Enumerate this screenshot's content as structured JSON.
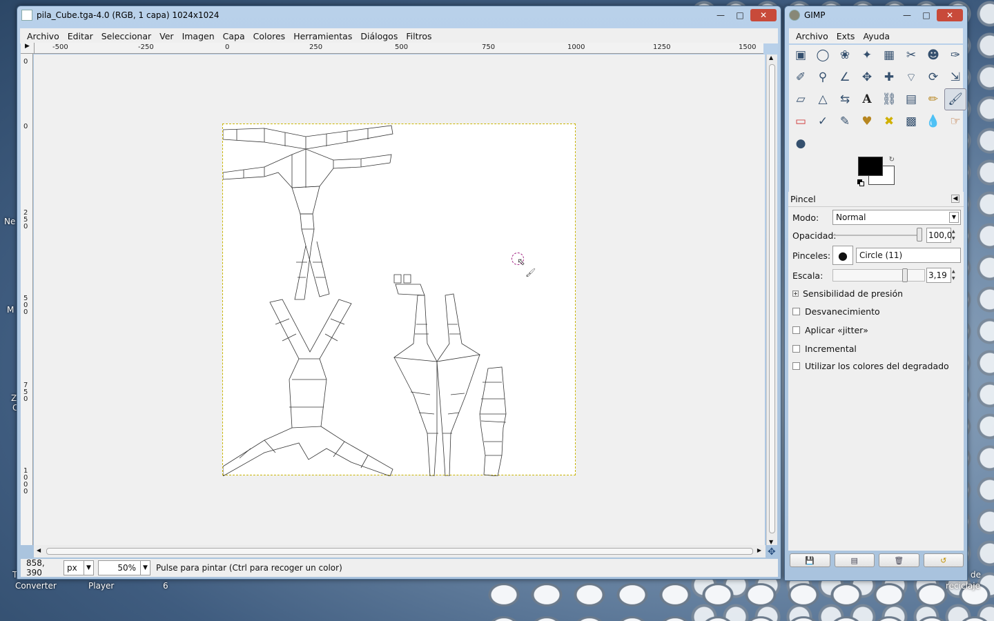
{
  "desktop": {
    "labels": [
      "Ne",
      "M",
      "Z",
      "C",
      "Converter",
      "Player",
      "6",
      "T",
      "de",
      "reciclaje"
    ]
  },
  "image_window": {
    "title": "pila_Cube.tga-4.0 (RGB, 1 capa) 1024x1024",
    "menu": [
      "Archivo",
      "Editar",
      "Seleccionar",
      "Ver",
      "Imagen",
      "Capa",
      "Colores",
      "Herramientas",
      "Diálogos",
      "Filtros"
    ],
    "ruler_top_labels": [
      "-500",
      "-250",
      "0",
      "250",
      "500",
      "750",
      "1000",
      "1250",
      "1500"
    ],
    "ruler_left_labels": [
      "0",
      "0",
      "250",
      "500",
      "750",
      "1000"
    ],
    "status": {
      "coords": "858, 390",
      "unit": "px",
      "zoom": "50%",
      "message": "Pulse para pintar (Ctrl para recoger un color)"
    }
  },
  "toolbox_window": {
    "title": "GIMP",
    "menu": [
      "Archivo",
      "Exts",
      "Ayuda"
    ],
    "tools": [
      "rect-select",
      "ellipse-select",
      "free-select",
      "fuzzy-select",
      "color-select",
      "scissors-select",
      "foreground-select",
      "paths",
      "color-picker",
      "zoom",
      "measure",
      "move",
      "align",
      "crop",
      "rotate",
      "scale",
      "shear",
      "perspective",
      "flip",
      "text",
      "bucket-fill",
      "blend",
      "pencil",
      "paintbrush",
      "eraser",
      "airbrush",
      "ink",
      "clone",
      "heal",
      "perspective-clone",
      "blur",
      "smudge",
      "dodge-burn"
    ],
    "active_tool": "paintbrush",
    "colors": {
      "foreground": "#000000",
      "background": "#ffffff"
    }
  },
  "tool_options": {
    "title": "Pincel",
    "mode_label": "Modo:",
    "mode_value": "Normal",
    "opacity_label": "Opacidad:",
    "opacity_value": "100,0",
    "opacity_fraction": 1.0,
    "brushes_label": "Pinceles:",
    "brush_name": "Circle (11)",
    "scale_label": "Escala:",
    "scale_value": "3,19",
    "scale_fraction": 0.79,
    "pressure_label": "Sensibilidad de presión",
    "checkboxes": [
      {
        "label": "Desvanecimiento",
        "checked": false
      },
      {
        "label": "Aplicar «jitter»",
        "checked": false
      },
      {
        "label": "Incremental",
        "checked": false
      },
      {
        "label": "Utilizar los colores del degradado",
        "checked": false
      }
    ]
  }
}
